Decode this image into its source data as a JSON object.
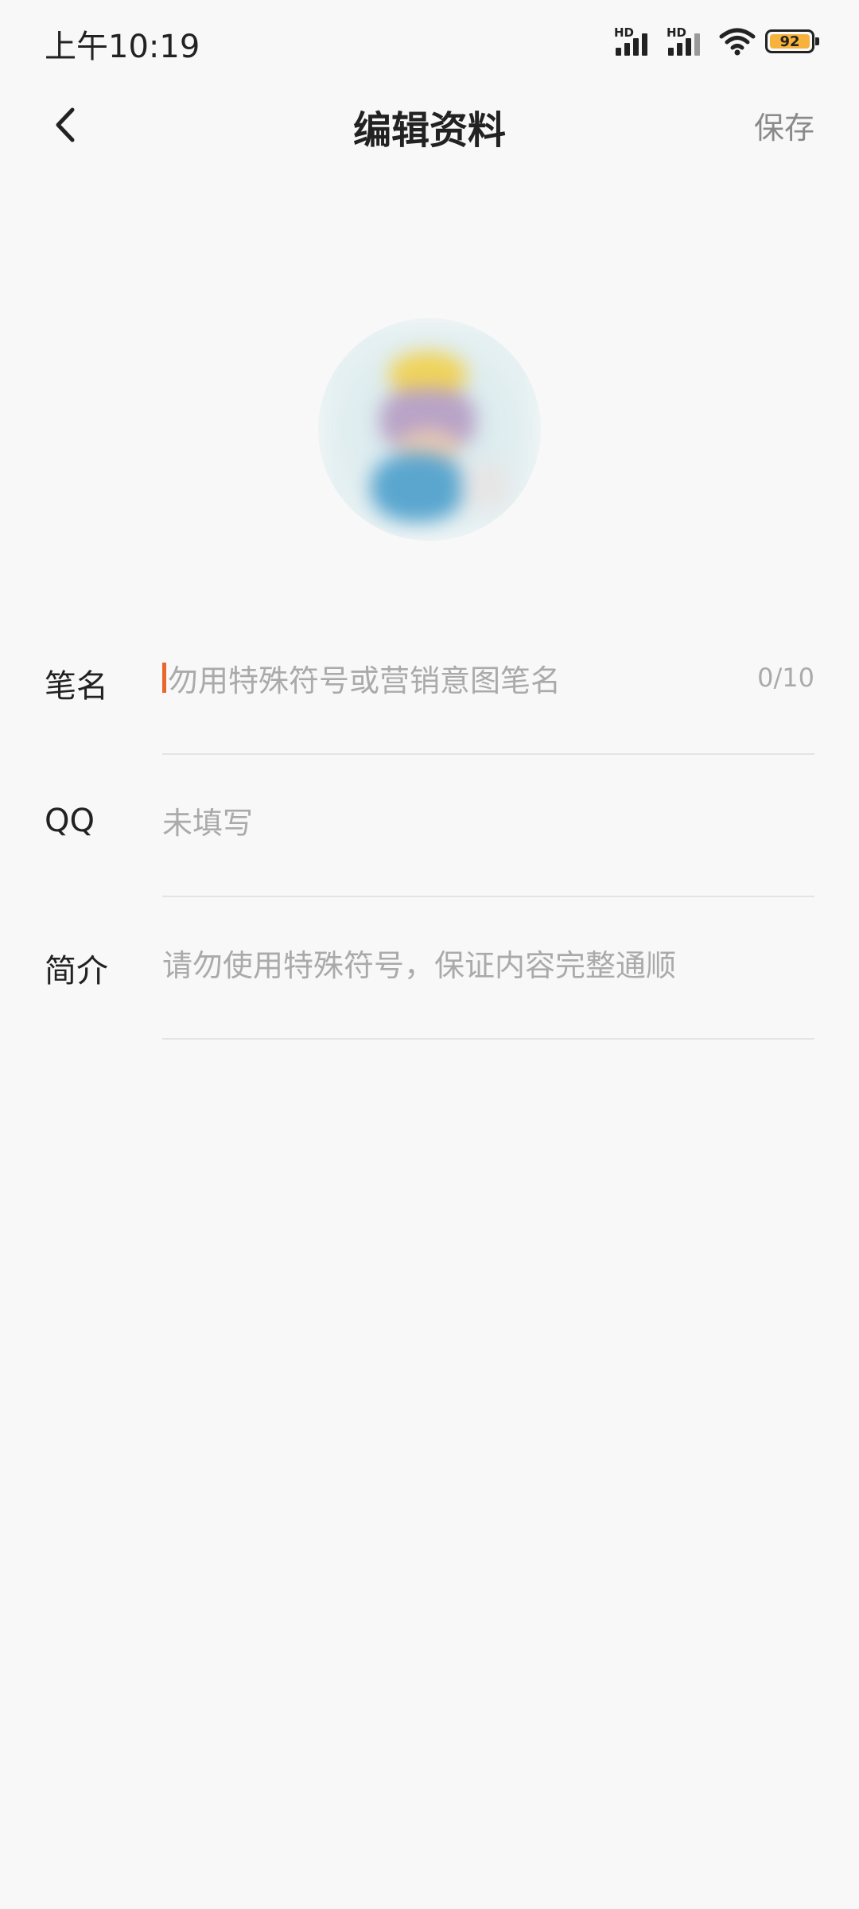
{
  "status_bar": {
    "time": "上午10:19",
    "signal_1_label": "HD",
    "signal_2_label": "HD",
    "battery_level": "92",
    "battery_color": "#f7b23b"
  },
  "nav": {
    "back_icon": "chevron-left-icon",
    "title": "编辑资料",
    "save_label": "保存"
  },
  "avatar": {
    "icon": "avatar-image"
  },
  "form": {
    "pen_name": {
      "label": "笔名",
      "placeholder": "勿用特殊符号或营销意图笔名",
      "value": "",
      "counter": "0/10",
      "cursor_color": "#e9672a"
    },
    "qq": {
      "label": "QQ",
      "placeholder": "未填写",
      "value": ""
    },
    "intro": {
      "label": "简介",
      "placeholder": "请勿使用特殊符号，保证内容完整通顺",
      "value": ""
    }
  }
}
